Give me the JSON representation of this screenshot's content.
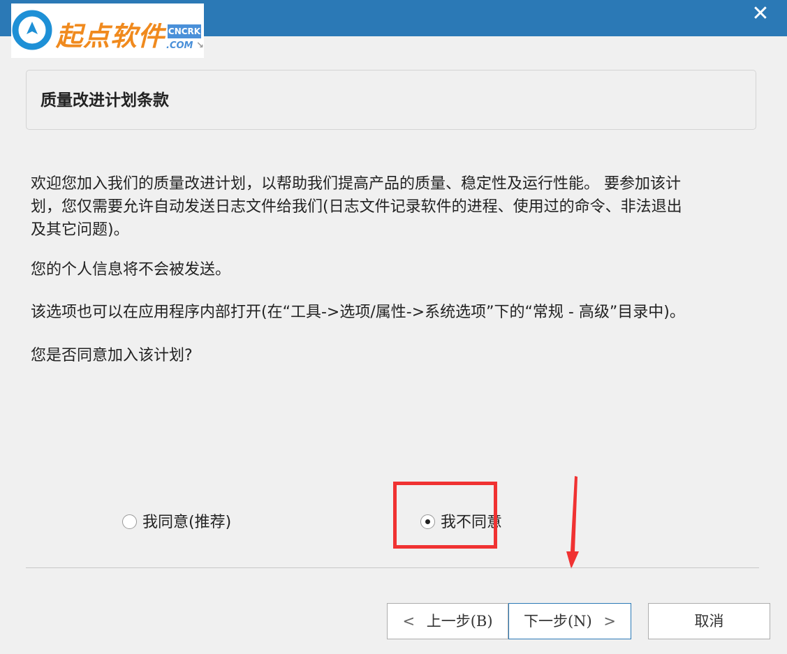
{
  "window": {
    "close_symbol": "✕",
    "accent_color": "#2b79b6"
  },
  "logo": {
    "text": "起点软件",
    "badge_top": "CNCRK",
    "badge_bottom": ".COM",
    "badge_arrow": "↘"
  },
  "section": {
    "title": "质量改进计划条款"
  },
  "content": {
    "paragraph1_line1": "欢迎您加入我们的质量改进计划，以帮助我们提高产品的质量、稳定性及运行性能。 要参加该计",
    "paragraph1_line2": "划，您仅需要允许自动发送日志文件给我们(日志文件记录软件的进程、使用过的命令、非法退出",
    "paragraph1_line3": "及其它问题)。",
    "paragraph2": "您的个人信息将不会被发送。",
    "paragraph3": "该选项也可以在应用程序内部打开(在“工具->选项/属性->系统选项”下的“常规 - 高级”目录中)。",
    "question": "您是否同意加入该计划?"
  },
  "options": {
    "agree_label": "我同意(推荐)",
    "disagree_label": "我不同意",
    "selected": "disagree"
  },
  "buttons": {
    "back_label": "上一步(B)",
    "back_chevron": "<",
    "next_label": "下一步(N)",
    "next_chevron": ">",
    "cancel_label": "取消"
  },
  "annotation": {
    "highlight_color": "#f03232"
  }
}
